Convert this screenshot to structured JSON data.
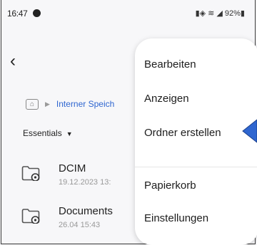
{
  "status_bar": {
    "time": "16:47",
    "icons": "▮◈ ≋ ◢ 92%▮"
  },
  "breadcrumb": {
    "home_icon": "home-icon",
    "separator": "▶",
    "current": "Interner Speich"
  },
  "filter": {
    "label": "Essentials",
    "caret": "▼"
  },
  "files": [
    {
      "name": "DCIM",
      "date": "19.12.2023 13:"
    },
    {
      "name": "Documents",
      "date": "26.04 15:43"
    }
  ],
  "menu": {
    "items": [
      "Bearbeiten",
      "Anzeigen",
      "Ordner erstellen",
      "Papierkorb",
      "Einstellungen"
    ]
  },
  "colors": {
    "link": "#2f66d0",
    "pointer": "#2f66d0"
  }
}
